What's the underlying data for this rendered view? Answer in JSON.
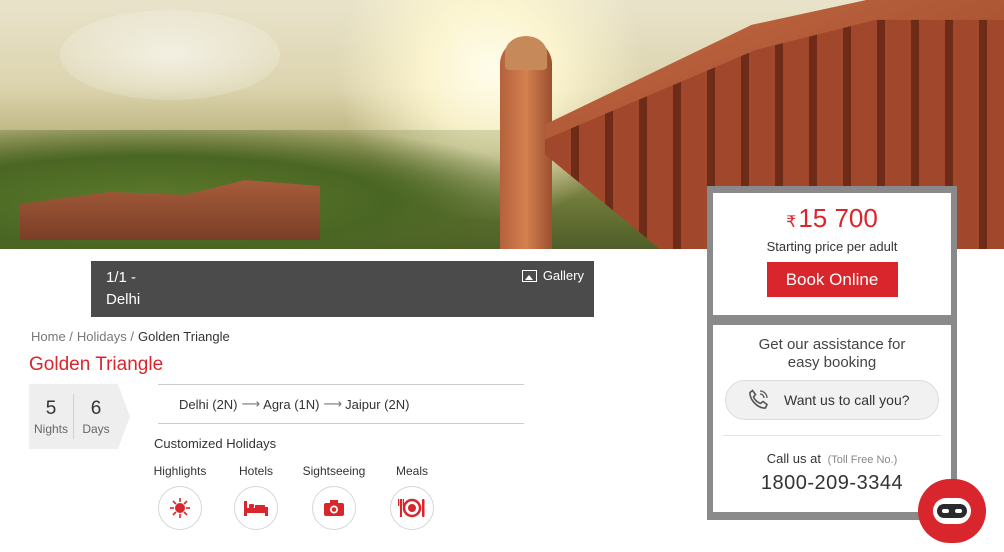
{
  "gallery": {
    "counter": "1/1  -",
    "city": "Delhi",
    "button_label": "Gallery"
  },
  "breadcrumb": {
    "home": "Home /",
    "holidays": "Holidays /",
    "current": "Golden Triangle"
  },
  "package": {
    "title": "Golden Triangle",
    "nights": "5",
    "nights_label": "Nights",
    "days": "6",
    "days_label": "Days",
    "route": [
      {
        "stop": "Delhi (2N)"
      },
      {
        "stop": "Agra (1N)"
      },
      {
        "stop": "Jaipur (2N)"
      }
    ],
    "category": "Customized Holidays"
  },
  "features": {
    "highlights": "Highlights",
    "hotels": "Hotels",
    "sightseeing": "Sightseeing",
    "meals": "Meals"
  },
  "pricing": {
    "currency": "₹",
    "amount": "15 700",
    "caption": "Starting price per adult",
    "book_label": "Book Online"
  },
  "assist": {
    "line1": "Get our assistance for",
    "line2": "easy booking",
    "call_button": "Want us to call you?",
    "call_us": "Call us at",
    "toll_free": "(Toll Free No.)",
    "phone": "1800-209-3344"
  },
  "colors": {
    "brand_red": "#d9262c",
    "dark_bar": "#4b4b4b"
  }
}
